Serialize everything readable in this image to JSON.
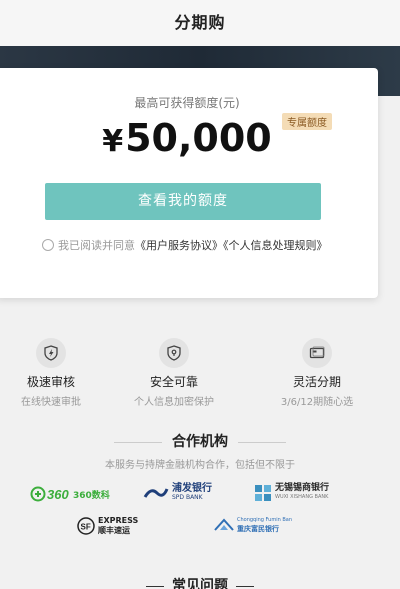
{
  "header": {
    "title": "分期购"
  },
  "card": {
    "limit_label": "最高可获得额度(元)",
    "currency": "¥",
    "amount": "50,000",
    "tag": "专属额度",
    "cta_label": "查看我的额度",
    "agree_prefix": "我已阅读并同意",
    "agree_link1": "《用户服务协议》",
    "agree_link2": "《个人信息处理规则》"
  },
  "features": [
    {
      "icon": "lightning-shield-icon",
      "title": "极速审核",
      "subtitle": "在线快速审批"
    },
    {
      "icon": "lock-shield-icon",
      "title": "安全可靠",
      "subtitle": "个人信息加密保护"
    },
    {
      "icon": "card-icon",
      "title": "灵活分期",
      "subtitle": "3/6/12期随心选"
    }
  ],
  "partners_section": {
    "title": "合作机构",
    "subtitle": "本服务与持牌金融机构合作，包括但不限于"
  },
  "partners": [
    {
      "icon": "360-logo-icon",
      "name": "360数科",
      "color": "#3cae3c"
    },
    {
      "icon": "spd-bank-logo-icon",
      "name": "浦发银行",
      "sub": "SPD BANK",
      "color": "#1f3f7a"
    },
    {
      "icon": "wuxi-bank-logo-icon",
      "name": "无锡锡商银行",
      "sub": "WUXI XISHANG BANK",
      "color": "#3a8fbe"
    },
    {
      "icon": "sf-express-logo-icon",
      "name": "顺丰速运",
      "sub": "EXPRESS",
      "color": "#222222"
    },
    {
      "icon": "fumin-bank-logo-icon",
      "name": "重庆富民银行",
      "sub": "Chongqing Fumin Ban",
      "color": "#2f6fb5"
    }
  ],
  "faq": {
    "title": "常见问题"
  },
  "colors": {
    "accent": "#6fc4be",
    "banner": "#1f2a36",
    "tag_bg": "#f4dcb6"
  }
}
